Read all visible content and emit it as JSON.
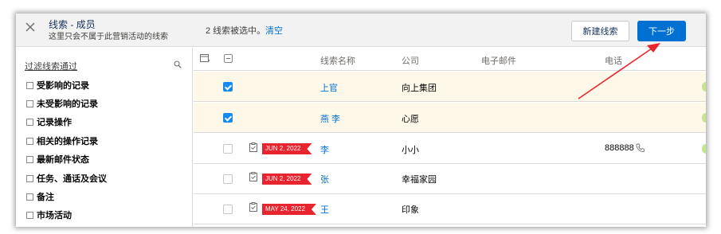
{
  "header": {
    "title": "线索 - 成员",
    "subtitle": "这里只会不属于此营销活动的线索",
    "selection_text": "2 线索被选中。",
    "clear_label": "清空",
    "new_lead_label": "新建线索",
    "next_label": "下一步"
  },
  "sidebar": {
    "filter_title": "过滤线索通过",
    "items": [
      {
        "label": "受影响的记录"
      },
      {
        "label": "未受影响的记录"
      },
      {
        "label": "记录操作"
      },
      {
        "label": "相关的操作记录"
      },
      {
        "label": "最新邮件状态"
      },
      {
        "label": "任务、通话及会议"
      },
      {
        "label": "备注"
      },
      {
        "label": "市场活动"
      }
    ]
  },
  "table": {
    "columns": [
      "线索名称",
      "公司",
      "电子邮件",
      "电话"
    ],
    "rows": [
      {
        "selected": true,
        "name": "上官",
        "company": "向上集团",
        "email": "",
        "phone": "",
        "flag": ""
      },
      {
        "selected": true,
        "name": "燕 李",
        "company": "心愿",
        "email": "",
        "phone": "",
        "flag": ""
      },
      {
        "selected": false,
        "name": "李",
        "company": "小小",
        "email": "",
        "phone": "888888",
        "flag": "JUN 2, 2022"
      },
      {
        "selected": false,
        "name": "张",
        "company": "幸福家园",
        "email": "",
        "phone": "",
        "flag": "JUN 2, 2022"
      },
      {
        "selected": false,
        "name": "王",
        "company": "印象",
        "email": "",
        "phone": "",
        "flag": "MAY 24, 2022"
      }
    ]
  },
  "colors": {
    "accent": "#0070d2",
    "flag": "#e8252e",
    "selected_row": "#fdf8e8",
    "arrow": "#e8252e"
  }
}
